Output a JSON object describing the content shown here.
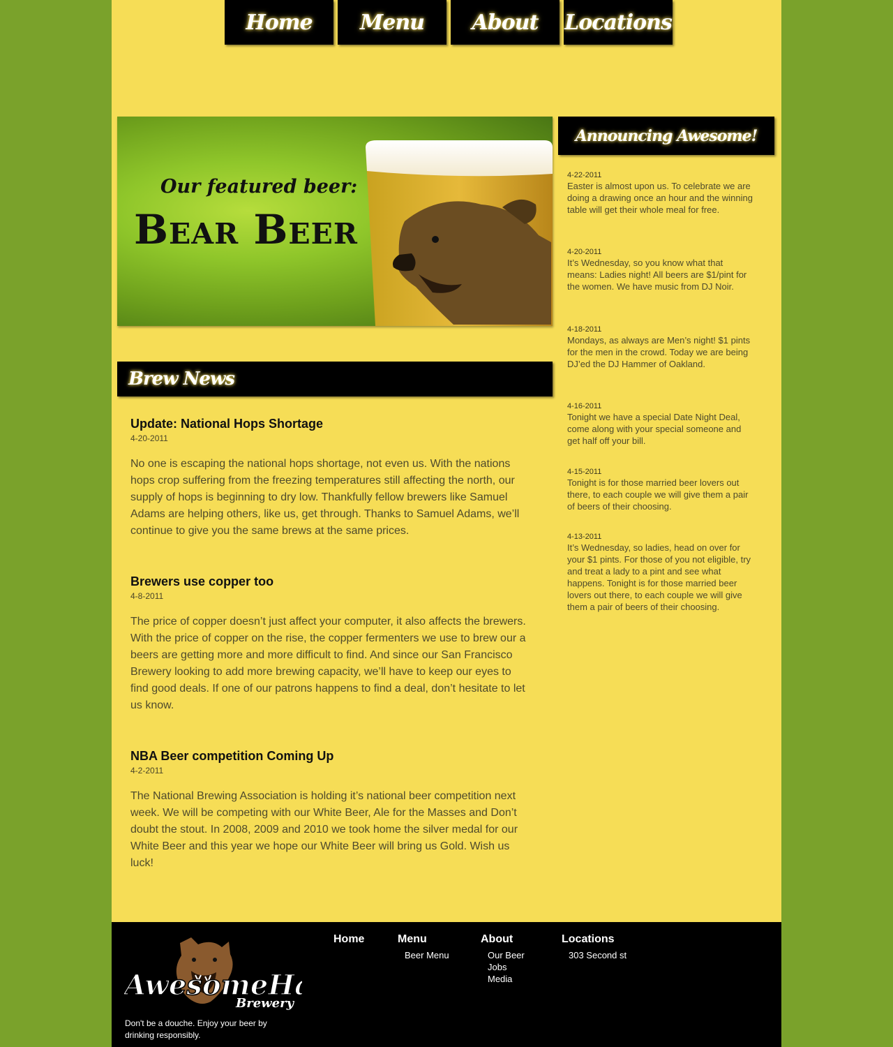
{
  "nav": {
    "items": [
      {
        "label": "Home"
      },
      {
        "label": "Menu"
      },
      {
        "label": "About"
      },
      {
        "label": "Locations"
      }
    ]
  },
  "hero": {
    "subtitle": "Our featured beer:",
    "title": "Bear Beer"
  },
  "news": {
    "header": "Brew News",
    "articles": [
      {
        "title": "Update: National Hops Shortage",
        "date": "4-20-2011",
        "body": "No one is escaping the national hops shortage, not even us. With the nations hops crop suffering from the freezing temperatures still affecting the north, our supply of hops is beginning to dry low. Thankfully fellow brewers like Samuel Adams are helping others, like us, get through. Thanks to Samuel Adams, we’ll continue to give you the same brews at the same prices."
      },
      {
        "title": "Brewers use copper too",
        "date": "4-8-2011",
        "body": "The price of copper doesn’t just affect your computer, it also affects the brewers. With the price of copper on the rise, the copper fermenters we use to brew our a beers are getting more and more difficult to find. And since our San Francisco Brewery looking to add more brewing capacity, we’ll have to keep our eyes to find good deals. If one of our patrons happens to find a deal, don’t hesitate to let us know."
      },
      {
        "title": "NBA Beer competition Coming Up",
        "date": "4-2-2011",
        "body": "The National Brewing Association is holding it’s national beer competition next week. We will be competing with our White Beer, Ale for the Masses and Don’t doubt the stout. In 2008, 2009 and 2010 we took home the silver medal for our White Beer and this year we hope our White Beer will bring us Gold. Wish us luck!"
      }
    ]
  },
  "announcements": {
    "header": "Announcing Awesome!",
    "items": [
      {
        "date": "4-22-2011",
        "text": "Easter is almost upon us. To celebrate we are doing a drawing once an hour and the winning table will get their whole meal for free."
      },
      {
        "date": "4-20-2011",
        "text": "It’s Wednesday, so you know what that means: Ladies night! All beers are $1/pint for the women. We have music from DJ Noir."
      },
      {
        "date": "4-18-2011",
        "text": "Mondays, as always are Men’s night! $1 pints for the men in the crowd. Today we are being DJ’ed the DJ Hammer of Oakland."
      },
      {
        "date": "4-16-2011",
        "text": "Tonight we have a special Date Night Deal, come along with your special someone and get half off your bill."
      },
      {
        "date": "4-15-2011",
        "text": "Tonight is for those married beer lovers out there, to each couple we will give them a pair of beers of their choosing."
      },
      {
        "date": "4-13-2011",
        "text": "It’s Wednesday, so ladies, head on over for your $1 pints. For those of you not eligible, try and treat a lady to a pint and see what happens. Tonight is for those married beer lovers out there, to each couple we will give them a pair of beers of their choosing."
      }
    ]
  },
  "footer": {
    "logo_text": "AwesomeHaus",
    "logo_sub": "Brewery",
    "tagline": "Don't be a douche. Enjoy your beer by drinking responsibly.",
    "columns": [
      {
        "heading": "Home",
        "links": []
      },
      {
        "heading": "Menu",
        "links": [
          "Beer Menu"
        ]
      },
      {
        "heading": "About",
        "links": [
          "Our Beer",
          "Jobs",
          "Media"
        ]
      },
      {
        "heading": "Locations",
        "links": [
          "303 Second st"
        ]
      }
    ]
  },
  "colors": {
    "background": "#7aa22b",
    "page": "#f6dd56",
    "bars": "#000000"
  }
}
